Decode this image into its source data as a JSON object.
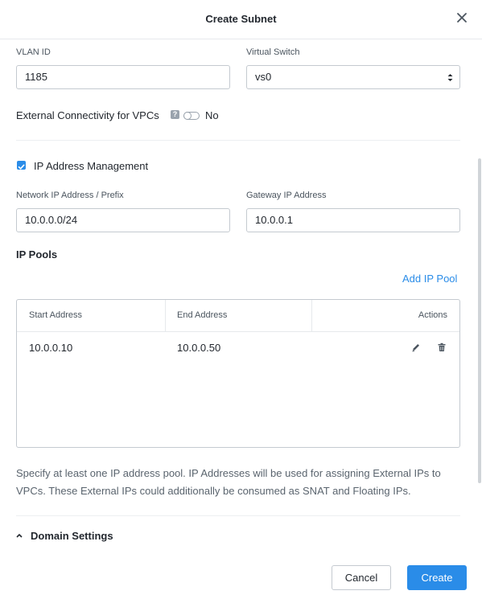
{
  "dialog": {
    "title": "Create Subnet"
  },
  "vlan": {
    "label": "VLAN ID",
    "value": "1185"
  },
  "virtual_switch": {
    "label": "Virtual Switch",
    "value": "vs0"
  },
  "external_connectivity": {
    "label": "External Connectivity for VPCs",
    "help": "?",
    "state": "No",
    "enabled": false
  },
  "ipam": {
    "label": "IP Address Management",
    "checked": true
  },
  "network_ip": {
    "label": "Network IP Address / Prefix",
    "value": "10.0.0.0/24"
  },
  "gateway_ip": {
    "label": "Gateway IP Address",
    "value": "10.0.0.1"
  },
  "ip_pools": {
    "title": "IP Pools",
    "add_label": "Add IP Pool",
    "columns": [
      "Start Address",
      "End Address",
      "Actions"
    ],
    "rows": [
      {
        "start": "10.0.0.10",
        "end": "10.0.0.50"
      }
    ],
    "help_text": "Specify at least one IP address pool. IP Addresses will be used for assigning External IPs to VPCs. These External IPs could additionally be consumed as SNAT and Floating IPs."
  },
  "domain_settings": {
    "label": "Domain Settings",
    "expanded": true
  },
  "footer": {
    "cancel_label": "Cancel",
    "create_label": "Create"
  },
  "colors": {
    "accent": "#2a8ce8",
    "border": "#c4cad0",
    "text": "#22272e",
    "muted": "#4a545e"
  }
}
